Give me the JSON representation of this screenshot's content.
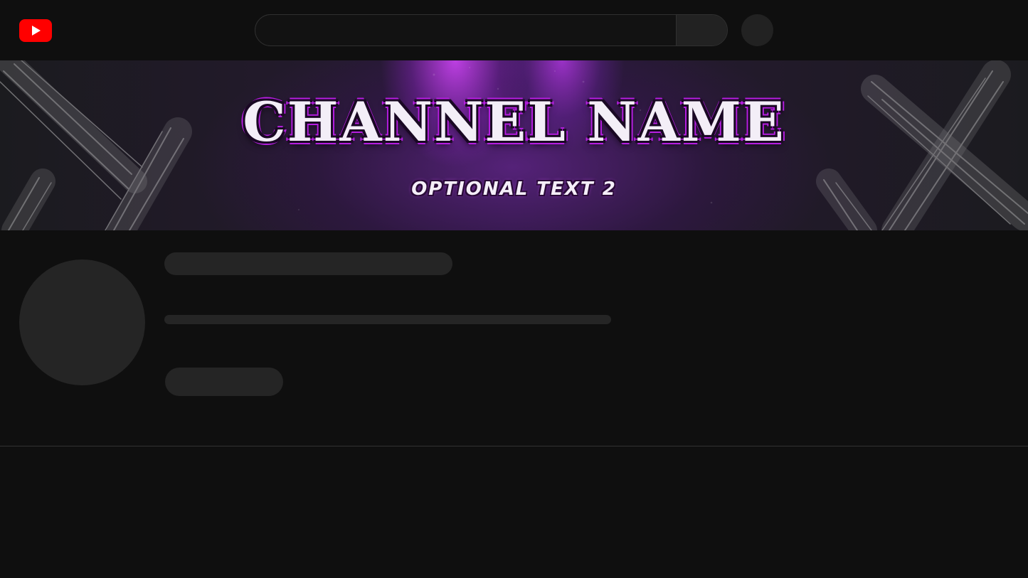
{
  "header": {
    "logo_icon": "youtube-play-icon",
    "logo_color": "#ff0000",
    "search": {
      "placeholder": "",
      "value": ""
    }
  },
  "banner": {
    "title": "CHANNEL NAME",
    "subtitle": "OPTIONAL TEXT 2",
    "accent_color": "#c026f0"
  },
  "channel": {
    "skeleton_color": "#252525"
  },
  "theme": {
    "background": "#0f0f0f"
  }
}
